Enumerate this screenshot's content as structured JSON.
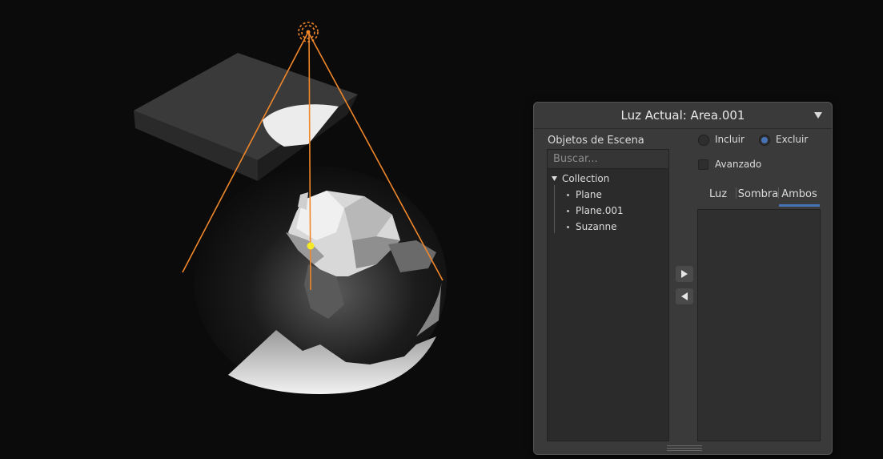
{
  "panel": {
    "title": "Luz Actual: Area.001",
    "scene_objects_label": "Objetos de Escena",
    "search_placeholder": "Buscar...",
    "tree": {
      "collection": "Collection",
      "items": [
        "Plane",
        "Plane.001",
        "Suzanne"
      ]
    },
    "mode": {
      "include_label": "Incluir",
      "exclude_label": "Excluir",
      "selected": "Excluir"
    },
    "advanced_label": "Avanzado",
    "advanced_checked": false,
    "tabs": [
      "Luz",
      "Sombra",
      "Ambos"
    ],
    "active_tab": "Ambos",
    "icons": {
      "collapse": "triangle-down-icon",
      "expand_tree": "triangle-down-icon",
      "move_right": "play-right-icon",
      "move_left": "play-left-icon"
    }
  },
  "colors": {
    "accent": "#4772b3",
    "light_gizmo": "#f0872a",
    "panel_bg": "#3a3a3a"
  }
}
